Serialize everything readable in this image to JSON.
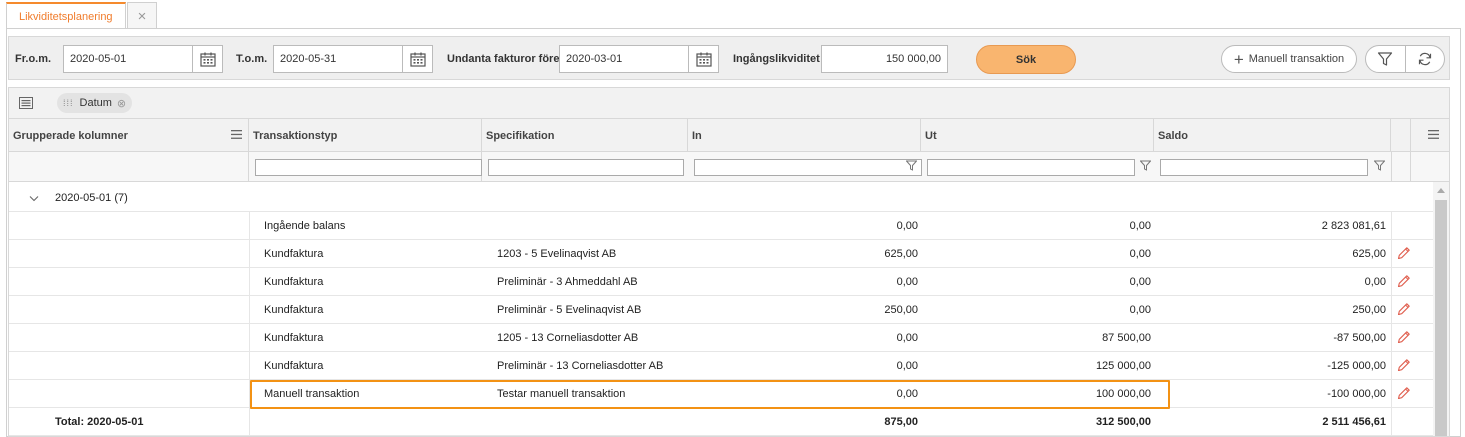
{
  "tabs": {
    "active": "Likviditetsplanering",
    "close": "×"
  },
  "filters": {
    "from_label": "Fr.o.m.",
    "from_value": "2020-05-01",
    "to_label": "T.o.m.",
    "to_value": "2020-05-31",
    "exclude_label": "Undanta fakturor före",
    "exclude_value": "2020-03-01",
    "opening_label": "Ingångslikviditet",
    "opening_value": "150 000,00",
    "search_label": "Sök",
    "manual_label": "Manuell transaktion"
  },
  "group_chip": "Datum",
  "columns": {
    "grouped": "Grupperade kolumner",
    "type": "Transaktionstyp",
    "spec": "Specifikation",
    "in": "In",
    "out": "Ut",
    "saldo": "Saldo"
  },
  "group": {
    "label": "2020-05-01 (7)"
  },
  "rows": [
    {
      "type": "Ingående balans",
      "spec": "",
      "in": "0,00",
      "out": "0,00",
      "saldo": "2 823 081,61",
      "editable": false
    },
    {
      "type": "Kundfaktura",
      "spec": "1203 - 5 Evelinaqvist AB",
      "in": "625,00",
      "out": "0,00",
      "saldo": "625,00",
      "editable": true
    },
    {
      "type": "Kundfaktura",
      "spec": "Preliminär - 3 Ahmeddahl AB",
      "in": "0,00",
      "out": "0,00",
      "saldo": "0,00",
      "editable": true
    },
    {
      "type": "Kundfaktura",
      "spec": "Preliminär - 5 Evelinaqvist AB",
      "in": "250,00",
      "out": "0,00",
      "saldo": "250,00",
      "editable": true
    },
    {
      "type": "Kundfaktura",
      "spec": "1205 - 13 Corneliasdotter AB",
      "in": "0,00",
      "out": "87 500,00",
      "saldo": "-87 500,00",
      "editable": true
    },
    {
      "type": "Kundfaktura",
      "spec": "Preliminär - 13 Corneliasdotter AB",
      "in": "0,00",
      "out": "125 000,00",
      "saldo": "-125 000,00",
      "editable": true
    },
    {
      "type": "Manuell transaktion",
      "spec": "Testar manuell transaktion",
      "in": "0,00",
      "out": "100 000,00",
      "saldo": "-100 000,00",
      "editable": true
    }
  ],
  "total": {
    "label": "Total: 2020-05-01",
    "in": "875,00",
    "out": "312 500,00",
    "saldo": "2 511 456,61"
  },
  "colors": {
    "accent": "#f58a2d",
    "highlight": "#f39214",
    "search_button": "#f9b56f",
    "pencil": "#e06050"
  }
}
